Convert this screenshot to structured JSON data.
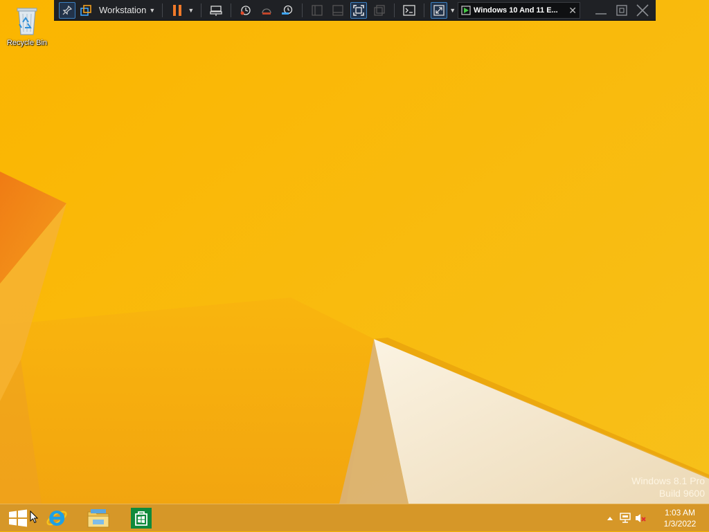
{
  "desktop": {
    "icons": [
      {
        "label": "Recycle Bin",
        "icon": "recycle-bin-icon"
      }
    ],
    "watermark": {
      "line1": "Windows 8.1 Pro",
      "line2": "Build 9600"
    }
  },
  "vmware": {
    "menu_label": "Workstation",
    "vm_tab_name": "Windows 10 And 11 E...",
    "icons": [
      "pin-icon",
      "library-icon",
      "pause-icon",
      "send-keys-icon",
      "snapshot-icon",
      "revert-icon",
      "snapshot-manager-icon",
      "single-view-icon",
      "library-view-icon",
      "fullscreen-icon",
      "unity-icon",
      "console-icon",
      "stretch-icon",
      "minimize-icon",
      "restore-icon",
      "close-icon"
    ],
    "colors": {
      "bar": "#1f2125",
      "pause": "#f07a2a",
      "accent": "#3d82c4"
    }
  },
  "taskbar": {
    "pinned": [
      "start-icon",
      "internet-explorer-icon",
      "file-explorer-icon",
      "store-icon"
    ],
    "tray": [
      "show-hidden-icons-icon",
      "network-icon",
      "volume-muted-icon"
    ],
    "clock": {
      "time": "1:03 AM",
      "date": "1/3/2022"
    }
  }
}
